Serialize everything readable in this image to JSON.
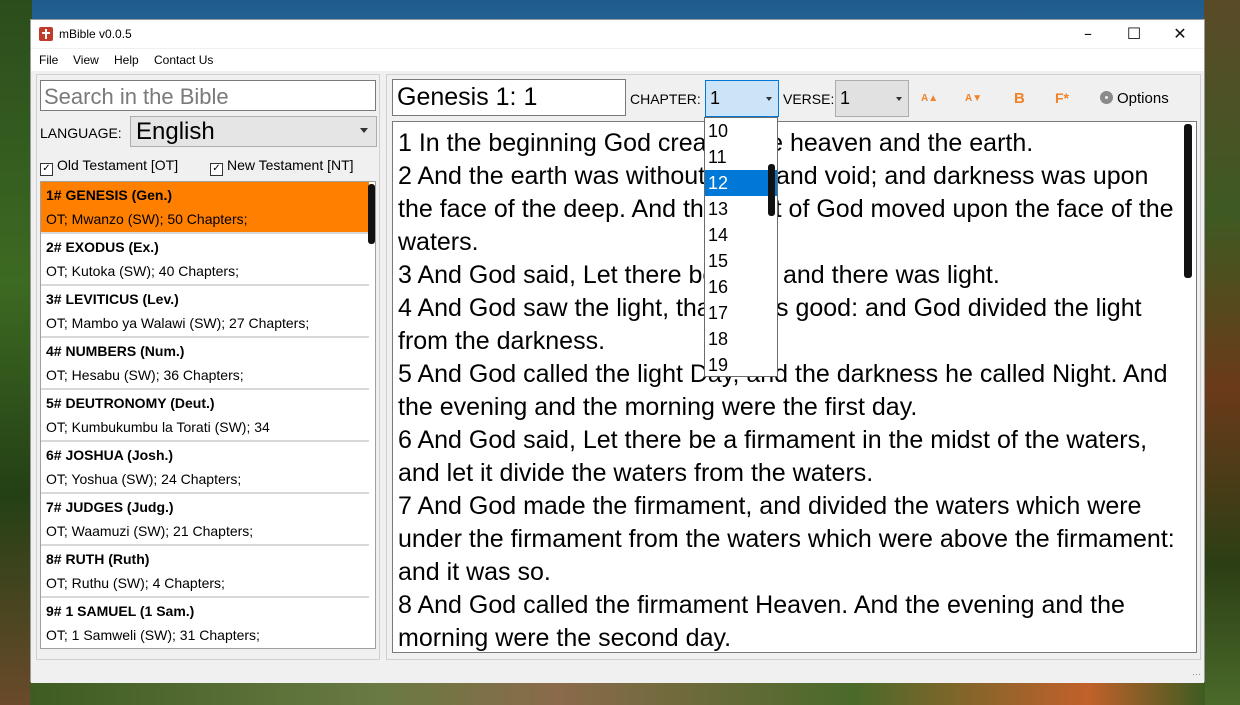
{
  "window": {
    "title": "mBible v0.0.5"
  },
  "menu": [
    "File",
    "View",
    "Help",
    "Contact Us"
  ],
  "search": {
    "placeholder": "Search in the Bible"
  },
  "language": {
    "label": "LANGUAGE:",
    "value": "English"
  },
  "filters": {
    "old_testament": "Old Testament [OT]",
    "new_testament": "New Testament [NT]"
  },
  "books": [
    {
      "title": "1# GENESIS (Gen.)",
      "info": "OT; Mwanzo (SW); 50 Chapters;"
    },
    {
      "title": "2# EXODUS (Ex.)",
      "info": "OT; Kutoka (SW); 40 Chapters;"
    },
    {
      "title": "3# LEVITICUS (Lev.)",
      "info": "OT; Mambo ya Walawi (SW); 27 Chapters;"
    },
    {
      "title": "4# NUMBERS (Num.)",
      "info": "OT; Hesabu (SW); 36 Chapters;"
    },
    {
      "title": "5# DEUTRONOMY (Deut.)",
      "info": "OT; Kumbukumbu la Torati (SW); 34"
    },
    {
      "title": "6# JOSHUA (Josh.)",
      "info": "OT; Yoshua (SW); 24 Chapters;"
    },
    {
      "title": "7# JUDGES (Judg.)",
      "info": "OT; Waamuzi (SW); 21 Chapters;"
    },
    {
      "title": "8# RUTH (Ruth)",
      "info": "OT; Ruthu (SW); 4 Chapters;"
    },
    {
      "title": "9# 1 SAMUEL (1 Sam.)",
      "info": "OT; 1 Samweli (SW); 31 Chapters;"
    }
  ],
  "reference": "Genesis 1: 1",
  "chapter": {
    "label": "CHAPTER:",
    "value": "1"
  },
  "verse": {
    "label": "VERSE:",
    "value": "1"
  },
  "chapter_dropdown": [
    "10",
    "11",
    "12",
    "13",
    "14",
    "15",
    "16",
    "17",
    "18",
    "19"
  ],
  "toolbar": {
    "font_up": "A▲",
    "font_down": "A▼",
    "bold": "B",
    "font_family": "F*",
    "options": "Options"
  },
  "text": "1 In the beginning God created the heaven and the earth.\n2 And the earth was without form, and void; and darkness was upon the face of the deep. And the Spirit of God moved upon the face of the waters.\n3 And God said, Let there be light: and there was light.\n4 And God saw the light, that it was good: and God divided the light from the darkness.\n5 And God called the light Day, and the darkness he called Night. And the evening and the morning were the first day.\n6 And God said, Let there be a firmament in the midst of the waters, and let it divide the waters from the waters.\n7 And God made the firmament, and divided the waters which were under the firmament from the waters which were above the firmament: and it was so.\n8 And God called the firmament Heaven. And the evening and the morning were the second day."
}
